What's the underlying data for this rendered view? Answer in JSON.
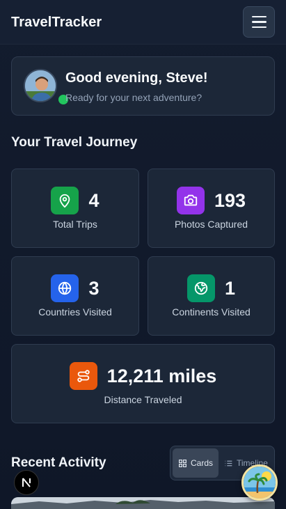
{
  "header": {
    "title": "TravelTracker",
    "menu_icon": "hamburger-menu-icon"
  },
  "greeting": {
    "title": "Good evening, Steve!",
    "subtitle": "Ready for your next adventure?"
  },
  "journey": {
    "title": "Your Travel Journey",
    "stats": [
      {
        "value": "4",
        "label": "Total Trips",
        "icon": "map-pin-icon",
        "color": "#16a34a"
      },
      {
        "value": "193",
        "label": "Photos Captured",
        "icon": "camera-icon",
        "color": "#9333ea"
      },
      {
        "value": "3",
        "label": "Countries Visited",
        "icon": "globe-icon",
        "color": "#2563eb"
      },
      {
        "value": "1",
        "label": "Continents Visited",
        "icon": "earth-icon",
        "color": "#059669"
      }
    ],
    "distance": {
      "value": "12,211 miles",
      "label": "Distance Traveled",
      "icon": "route-icon",
      "color": "#ea580c"
    }
  },
  "activity": {
    "title": "Recent Activity",
    "view_toggle": {
      "cards_label": "Cards",
      "timeline_label": "Timeline",
      "selected": "Cards"
    }
  }
}
